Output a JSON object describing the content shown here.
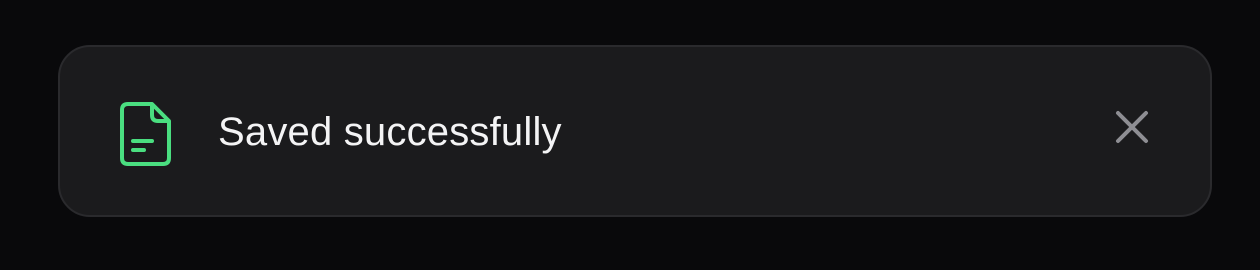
{
  "toast": {
    "message": "Saved successfully",
    "icon": "file-document-icon",
    "close_icon": "close-icon",
    "accent_color": "#4ade80",
    "background_color": "#1b1b1d",
    "close_icon_color": "#8e8e93"
  }
}
